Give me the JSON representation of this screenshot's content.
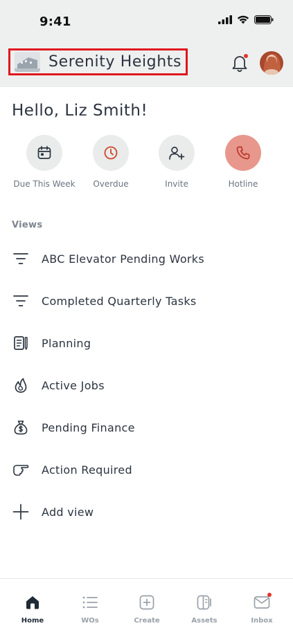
{
  "status_bar": {
    "time": "9:41"
  },
  "header": {
    "property_name": "Serenity Heights",
    "icons": {
      "notifications": "bell-icon",
      "profile": "avatar"
    }
  },
  "greeting": "Hello, Liz Smith!",
  "quick_actions": [
    {
      "label": "Due This Week",
      "icon": "calendar-icon"
    },
    {
      "label": "Overdue",
      "icon": "clock-icon"
    },
    {
      "label": "Invite",
      "icon": "add-user-icon"
    },
    {
      "label": "Hotline",
      "icon": "phone-icon"
    }
  ],
  "views": {
    "title": "Views",
    "items": [
      {
        "label": "ABC Elevator Pending Works",
        "icon": "filter-icon"
      },
      {
        "label": "Completed Quarterly Tasks",
        "icon": "filter-icon"
      },
      {
        "label": "Planning",
        "icon": "notebook-icon"
      },
      {
        "label": "Active Jobs",
        "icon": "flame-icon"
      },
      {
        "label": "Pending Finance",
        "icon": "money-bag-icon"
      },
      {
        "label": "Action Required",
        "icon": "pointing-hand-icon"
      },
      {
        "label": "Add view",
        "icon": "plus-icon"
      }
    ]
  },
  "tabbar": {
    "active": "Home",
    "tabs": [
      {
        "label": "Home",
        "icon": "home-icon"
      },
      {
        "label": "WOs",
        "icon": "list-icon"
      },
      {
        "label": "Create",
        "icon": "create-icon"
      },
      {
        "label": "Assets",
        "icon": "assets-icon"
      },
      {
        "label": "Inbox",
        "icon": "inbox-icon"
      }
    ]
  },
  "colors": {
    "accent": "#e8978c",
    "badge": "#e0362c",
    "highlight_box": "#e0161e",
    "header_bg": "#eef0ef"
  }
}
